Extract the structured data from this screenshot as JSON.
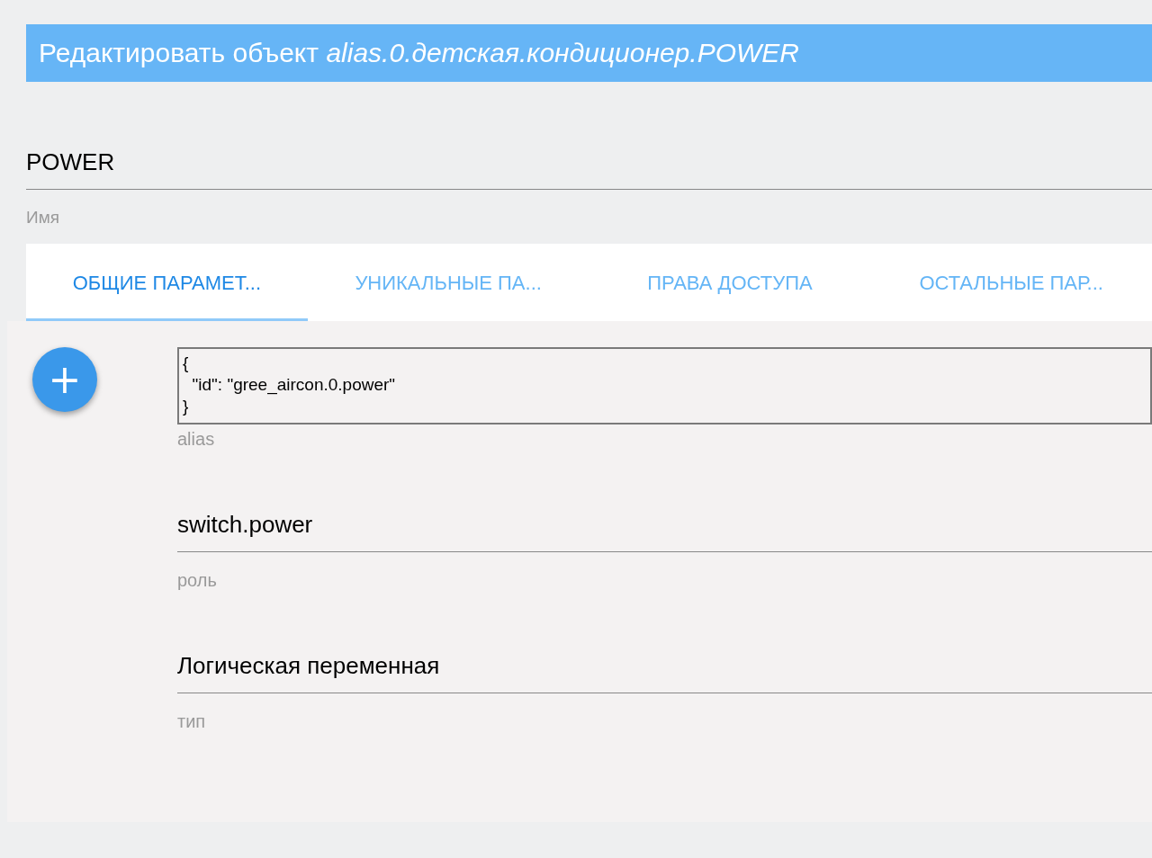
{
  "dialog": {
    "title": "Редактировать объект *alias.0.детская.кондиционер.POWER*"
  },
  "name_field": {
    "value": "POWER",
    "label": "Имя"
  },
  "tabs": [
    {
      "label": "ОБЩИЕ ПАРАМЕТ...",
      "selected": true
    },
    {
      "label": "УНИКАЛЬНЫЕ ПА...",
      "selected": false
    },
    {
      "label": "ПРАВА ДОСТУПА",
      "selected": false
    },
    {
      "label": "ОСТАЛЬНЫЕ ПАР...",
      "selected": false
    }
  ],
  "add_button": {
    "label": "+"
  },
  "fields": [
    {
      "kind": "textarea",
      "value": "{\n  \"id\": \"gree_aircon.0.power\"\n}",
      "label": "alias"
    },
    {
      "kind": "text",
      "value": "switch.power",
      "label": "роль"
    },
    {
      "kind": "text",
      "value": "Логическая переменная",
      "label": "тип"
    }
  ]
}
